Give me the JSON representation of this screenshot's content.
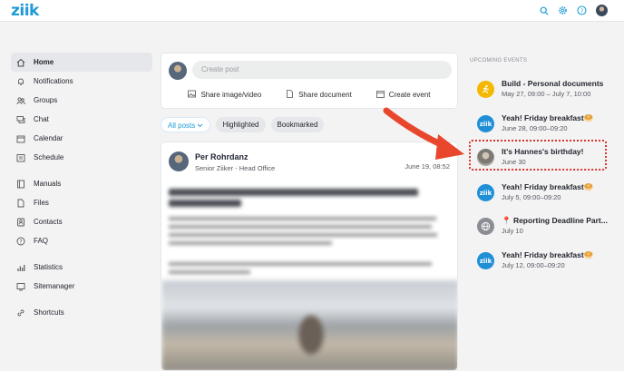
{
  "app": {
    "logo_text": "ziik"
  },
  "topbar": {
    "icons": [
      "search-icon",
      "gear-icon",
      "help-icon",
      "avatar"
    ]
  },
  "sidebar": {
    "items": [
      {
        "label": "Home",
        "icon": "home-icon",
        "active": true
      },
      {
        "label": "Notifications",
        "icon": "bell-icon"
      },
      {
        "label": "Groups",
        "icon": "groups-icon"
      },
      {
        "label": "Chat",
        "icon": "chat-icon"
      },
      {
        "label": "Calendar",
        "icon": "calendar-icon"
      },
      {
        "label": "Schedule",
        "icon": "schedule-icon"
      },
      {
        "label": "Manuals",
        "icon": "manual-icon"
      },
      {
        "label": "Files",
        "icon": "files-icon"
      },
      {
        "label": "Contacts",
        "icon": "contacts-icon"
      },
      {
        "label": "FAQ",
        "icon": "faq-icon"
      },
      {
        "label": "Statistics",
        "icon": "statistics-icon"
      },
      {
        "label": "Sitemanager",
        "icon": "sitemanager-icon"
      },
      {
        "label": "Shortcuts",
        "icon": "link-icon"
      }
    ]
  },
  "composer": {
    "placeholder": "Create post",
    "actions": [
      {
        "label": "Share image/video",
        "icon": "image-icon"
      },
      {
        "label": "Share document",
        "icon": "document-icon"
      },
      {
        "label": "Create event",
        "icon": "event-icon"
      }
    ]
  },
  "filters": {
    "all_posts": "All posts",
    "highlighted": "Highlighted",
    "bookmarked": "Bookmarked"
  },
  "post": {
    "author": "Per Rohrdanz",
    "role": "Senior Ziiker - Head Office",
    "date": "June 19, 08:52",
    "more": "···"
  },
  "events": {
    "title": "UPCOMING EVENTS",
    "items": [
      {
        "title": "Build - Personal documents",
        "date": "May 27, 09:00 – July 7, 10:00",
        "icon": "running-icon",
        "color": "#f5b800"
      },
      {
        "title": "Yeah! Friday breakfast🥯",
        "date": "June 28, 09:00–09:20",
        "icon": "ziik-icon",
        "color": "#1f8fd6"
      },
      {
        "title": "It's Hannes's birthday!",
        "date": "June 30",
        "icon": "avatar",
        "color": "#8a8d93"
      },
      {
        "title": "Yeah! Friday breakfast🥯",
        "date": "July 5, 09:00–09:20",
        "icon": "ziik-icon",
        "color": "#1f8fd6"
      },
      {
        "title": "📍 Reporting Deadline Part...",
        "date": "July 10",
        "icon": "globe-icon",
        "color": "#8a8d93"
      },
      {
        "title": "Yeah! Friday breakfast🥯",
        "date": "July 12, 09:00–09:20",
        "icon": "ziik-icon",
        "color": "#1f8fd6"
      }
    ]
  },
  "colors": {
    "brand": "#1f9bd7",
    "highlight": "#d9342b",
    "arrow": "#e8472d"
  }
}
